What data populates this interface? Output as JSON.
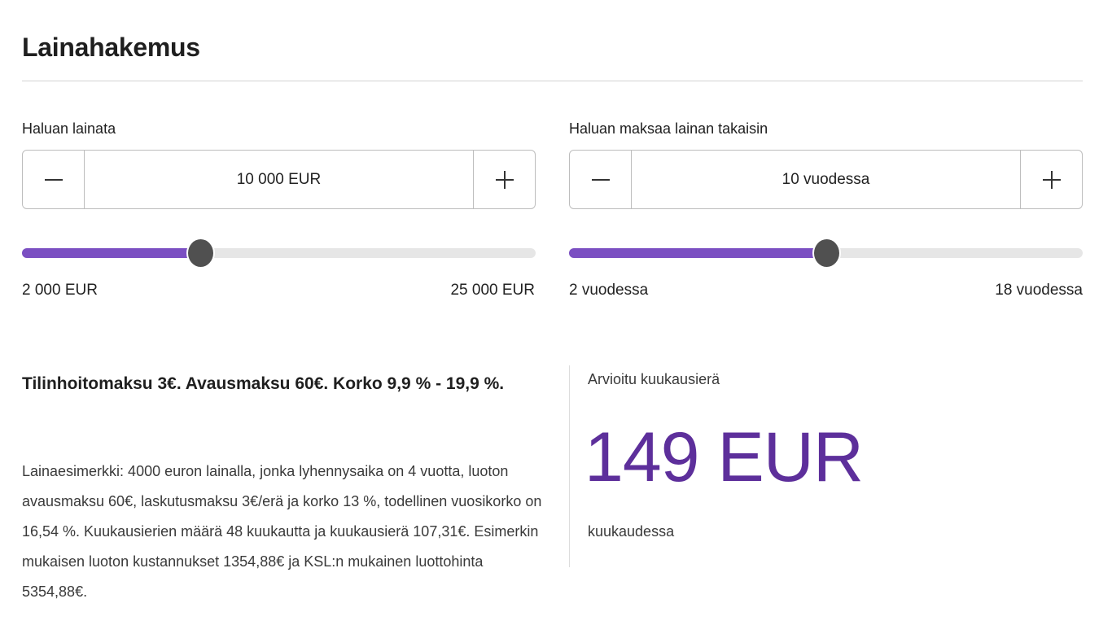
{
  "page": {
    "title": "Lainahakemus"
  },
  "loan_amount": {
    "label": "Haluan lainata",
    "value": "10 000 EUR",
    "minus_icon": "minus-icon",
    "plus_icon": "plus-icon",
    "slider": {
      "min_label": "2 000 EUR",
      "max_label": "25 000 EUR",
      "min": 2000,
      "max": 25000,
      "value": 10000
    }
  },
  "loan_term": {
    "label": "Haluan maksaa lainan takaisin",
    "value": "10 vuodessa",
    "minus_icon": "minus-icon",
    "plus_icon": "plus-icon",
    "slider": {
      "min_label": "2 vuodessa",
      "max_label": "18 vuodessa",
      "min": 2,
      "max": 18,
      "value": 10
    }
  },
  "fees": {
    "title": "Tilinhoitomaksu 3€. Avausmaksu 60€. Korko 9,9 % - 19,9 %.",
    "example": "Lainaesimerkki: 4000 euron lainalla, jonka lyhennysaika on 4 vuotta, luoton avausmaksu 60€, laskutusmaksu 3€/erä ja korko 13 %, todellinen vuosikorko on 16,54 %. Kuukausierien määrä 48 kuukautta ja kuukausierä 107,31€. Esimerkin mukaisen luoton kustannukset 1354,88€ ja KSL:n mukainen luottohinta 5354,88€."
  },
  "estimate": {
    "label": "Arvioitu kuukausierä",
    "amount": "149 EUR",
    "unit": "kuukaudessa"
  },
  "colors": {
    "accent": "#7b4fc2",
    "amount": "#5d2f9b",
    "thumb": "#505050",
    "track": "#e6e6e6"
  }
}
